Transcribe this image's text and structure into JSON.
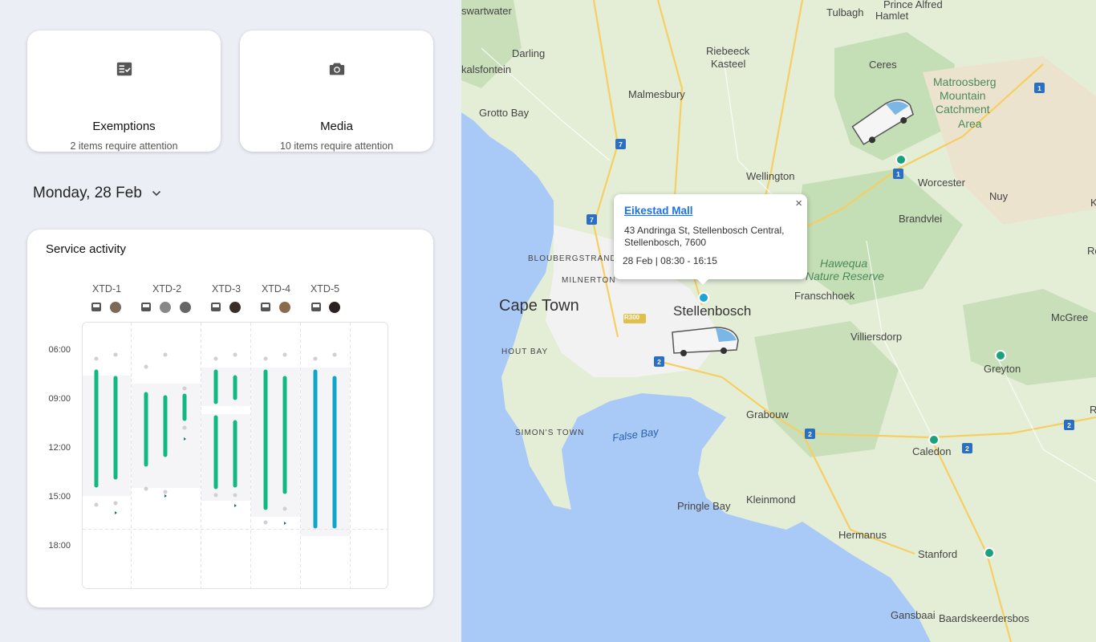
{
  "tiles": {
    "exemptions": {
      "title": "Exemptions",
      "subtitle": "2 items require attention"
    },
    "media": {
      "title": "Media",
      "subtitle": "10 items require attention"
    }
  },
  "date": {
    "label": "Monday, 28 Feb"
  },
  "activity": {
    "title": "Service activity",
    "columns": [
      "XTD-1",
      "XTD-2",
      "XTD-3",
      "XTD-4",
      "XTD-5"
    ],
    "time_labels": [
      "06:00",
      "09:00",
      "12:00",
      "15:00",
      "18:00"
    ]
  },
  "map": {
    "popup": {
      "place": "Eikestad Mall",
      "address": "43 Andringa St, Stellenbosch Central, Stellenbosch, 7600",
      "time": "28 Feb  | 08:30 - 16:15",
      "close": "×"
    },
    "labels": {
      "swartwater": "swartwater",
      "tulbagh": "Tulbagh",
      "prince_alfred": "Prince Alfred",
      "hamlet": "Hamlet",
      "darling": "Darling",
      "riebeeck": "Riebeeck",
      "kasteel": "Kasteel",
      "ceres": "Ceres",
      "kalsfontein": "kalsfontein",
      "matroosberg": "Matroosberg",
      "mountain": "Mountain",
      "catchment": "Catchment",
      "area": "Area",
      "malmesbury": "Malmesbury",
      "grotto_bay": "Grotto Bay",
      "wellington": "Wellington",
      "worcester": "Worcester",
      "nuy": "Nuy",
      "brandvlei": "Brandvlei",
      "bloubergstrand": "BLOUBERGSTRAND",
      "hawequa": "Hawequa",
      "nature_reserve": "Nature Reserve",
      "milnerton": "MILNERTON",
      "cape_town": "Cape Town",
      "stellenbosch": "Stellenbosch",
      "franschhoek": "Franschhoek",
      "mcgregor": "McGree",
      "villiersdorp": "Villiersdorp",
      "hout_bay": "HOUT BAY",
      "greyton": "Greyton",
      "grabouw": "Grabouw",
      "simons_town": "SIMON'S TOWN",
      "false_bay": "False Bay",
      "caledon": "Caledon",
      "pringle_bay": "Pringle Bay",
      "kleinmond": "Kleinmond",
      "hermanus": "Hermanus",
      "stanford": "Stanford",
      "gansbaai": "Gansbaai",
      "baardskeerdersbos": "Baardskeerdersbos",
      "r300": "R300",
      "ko": "Ko",
      "ro": "Ro",
      "riv": "Riv"
    },
    "route_shields": [
      "7",
      "7",
      "7",
      "1",
      "1",
      "2",
      "2",
      "2",
      "2",
      "2"
    ]
  }
}
